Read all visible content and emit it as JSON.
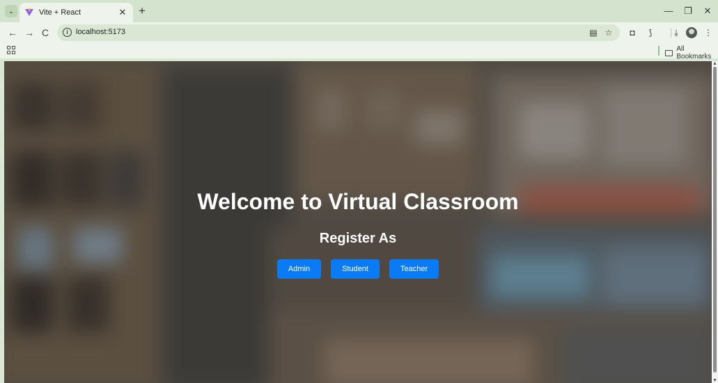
{
  "browser": {
    "tab_title": "Vite + React",
    "tab_close": "✕",
    "new_tab": "+",
    "tab_search_glyph": "⌄",
    "minimize": "—",
    "restore": "❐",
    "close": "✕",
    "url": "localhost:5173",
    "bookmarks_all": "All Bookmarks",
    "icons": {
      "back": "←",
      "forward": "→",
      "reload": "C",
      "translate": "▤",
      "star": "☆",
      "camera": "◘",
      "extensions": "⟆",
      "download": "⤓",
      "menu": "⋮"
    }
  },
  "page": {
    "title": "Welcome to Virtual Classroom",
    "subtitle": "Register As",
    "buttons": [
      "Admin",
      "Student",
      "Teacher"
    ],
    "button_color": "#0a7bf5"
  },
  "scrollbar": {
    "up": "▲",
    "down": "▼"
  }
}
